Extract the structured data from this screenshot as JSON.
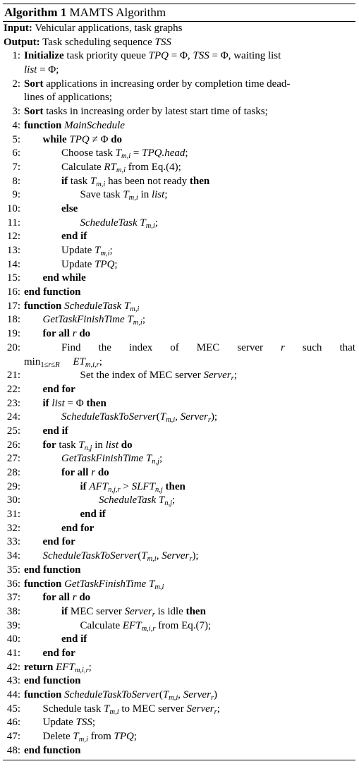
{
  "caption": {
    "prefix": "Algorithm 1",
    "title": "MAMTS Algorithm"
  },
  "input": {
    "label": "Input:",
    "text": "Vehicular applications, task graphs"
  },
  "output": {
    "label": "Output:",
    "text": "Task scheduling sequence ",
    "var": "TSS"
  },
  "lines": [
    {
      "n": "1:",
      "i": 0,
      "html": "<span class='kw'>Initialize</span> task priority queue <span class='it'>TPQ</span> = Φ, <span class='it'>TSS</span> = Φ, waiting list"
    },
    {
      "n": "",
      "i": 0,
      "html": "<span class='it'>list</span> = Φ;"
    },
    {
      "n": "2:",
      "i": 0,
      "html": "<span class='kw'>Sort</span> applications in increasing order by completion time dead-"
    },
    {
      "n": "",
      "i": 0,
      "html": "lines of applications;"
    },
    {
      "n": "3:",
      "i": 0,
      "html": "<span class='kw'>Sort</span> tasks in increasing order by latest start time of tasks;"
    },
    {
      "n": "4:",
      "i": 0,
      "html": "<span class='kw'>function</span> <span class='it'>MainSchedule</span>"
    },
    {
      "n": "5:",
      "i": 1,
      "html": "<span class='kw'>while</span> <span class='it'>TPQ</span> ≠ Φ <span class='kw'>do</span>"
    },
    {
      "n": "6:",
      "i": 2,
      "html": "Choose task <span class='it'>T<sub>m,i</sub></span> = <span class='it'>TPQ.head</span>;"
    },
    {
      "n": "7:",
      "i": 2,
      "html": "Calculate <span class='it'>RT<sub>m,i</sub></span> from Eq.(4);"
    },
    {
      "n": "8:",
      "i": 2,
      "html": "<span class='kw'>if</span> task <span class='it'>T<sub>m,i</sub></span> has been not ready <span class='kw'>then</span>"
    },
    {
      "n": "9:",
      "i": 3,
      "html": "Save task <span class='it'>T<sub>m,i</sub></span> in <span class='it'>list</span>;"
    },
    {
      "n": "10:",
      "i": 2,
      "html": "<span class='kw'>else</span>"
    },
    {
      "n": "11:",
      "i": 3,
      "html": "<span class='it'>ScheduleTask T<sub>m,i</sub></span>;"
    },
    {
      "n": "12:",
      "i": 2,
      "html": "<span class='kw'>end if</span>"
    },
    {
      "n": "13:",
      "i": 2,
      "html": "Update <span class='it'>T<sub>m,i</sub></span>;"
    },
    {
      "n": "14:",
      "i": 2,
      "html": "Update <span class='it'>TPQ</span>;"
    },
    {
      "n": "15:",
      "i": 1,
      "html": "<span class='kw'>end while</span>"
    },
    {
      "n": "16:",
      "i": 0,
      "html": "<span class='kw'>end function</span>"
    },
    {
      "n": "17:",
      "i": 0,
      "html": "<span class='kw'>function</span> <span class='it'>ScheduleTask T<sub>m,i</sub></span>"
    },
    {
      "n": "18:",
      "i": 1,
      "html": "<span class='it'>GetTaskFinishTime T<sub>m,i</sub></span>;"
    },
    {
      "n": "19:",
      "i": 1,
      "html": "<span class='kw'>for all</span> <span class='it'>r</span> <span class='kw'>do</span>"
    },
    {
      "n": "20:",
      "i": 2,
      "justify": true,
      "words": [
        "Find",
        "the",
        "index",
        "of",
        "MEC",
        "server",
        "<span class='it'>r</span>",
        "such",
        "that"
      ]
    },
    {
      "n": "",
      "i": 0,
      "html": "min<sub>1≤<span class='it'>r</span>≤<span class='it'>R</span></sub> &nbsp;&nbsp;&nbsp;&nbsp;<span class='it'>ET<sub>m,i,r</sub></span>;"
    },
    {
      "n": "21:",
      "i": 3,
      "html": "Set the index of MEC server <span class='it'>Server<sub>r</sub></span>;"
    },
    {
      "n": "22:",
      "i": 1,
      "html": "<span class='kw'>end for</span>"
    },
    {
      "n": "23:",
      "i": 1,
      "html": "<span class='kw'>if</span> <span class='it'>list</span> = Φ <span class='kw'>then</span>"
    },
    {
      "n": "24:",
      "i": 2,
      "html": "<span class='it'>ScheduleTaskToServer</span>(<span class='it'>T<sub>m,i</sub></span>, <span class='it'>Server<sub>r</sub></span>);"
    },
    {
      "n": "25:",
      "i": 1,
      "html": "<span class='kw'>end if</span>"
    },
    {
      "n": "26:",
      "i": 1,
      "html": "<span class='kw'>for</span> task <span class='it'>T<sub>n,j</sub></span> in <span class='it'>list</span> <span class='kw'>do</span>"
    },
    {
      "n": "27:",
      "i": 2,
      "html": "<span class='it'>GetTaskFinishTime T<sub>n,j</sub></span>;"
    },
    {
      "n": "28:",
      "i": 2,
      "html": "<span class='kw'>for all</span> <span class='it'>r</span> <span class='kw'>do</span>"
    },
    {
      "n": "29:",
      "i": 3,
      "html": "<span class='kw'>if</span> <span class='it'>AFT<sub>n,j,r</sub></span> &gt; <span class='it'>SLFT<sub>n,j</sub></span> <span class='kw'>then</span>"
    },
    {
      "n": "30:",
      "i": 4,
      "html": "<span class='it'>ScheduleTask T<sub>n,j</sub></span>;"
    },
    {
      "n": "31:",
      "i": 3,
      "html": "<span class='kw'>end if</span>"
    },
    {
      "n": "32:",
      "i": 2,
      "html": "<span class='kw'>end for</span>"
    },
    {
      "n": "33:",
      "i": 1,
      "html": "<span class='kw'>end for</span>"
    },
    {
      "n": "34:",
      "i": 1,
      "html": "<span class='it'>ScheduleTaskToServer</span>(<span class='it'>T<sub>m,i</sub></span>, <span class='it'>Server<sub>r</sub></span>);"
    },
    {
      "n": "35:",
      "i": 0,
      "html": "<span class='kw'>end function</span>"
    },
    {
      "n": "36:",
      "i": 0,
      "html": "<span class='kw'>function</span> <span class='it'>GetTaskFinishTime T<sub>m,i</sub></span>"
    },
    {
      "n": "37:",
      "i": 1,
      "html": "<span class='kw'>for all</span> <span class='it'>r</span> <span class='kw'>do</span>"
    },
    {
      "n": "38:",
      "i": 2,
      "html": "<span class='kw'>if</span> MEC server <span class='it'>Server<sub>r</sub></span> is idle <span class='kw'>then</span>"
    },
    {
      "n": "39:",
      "i": 3,
      "html": "Calculate <span class='it'>EFT<sub>m,i,r</sub></span> from Eq.(7);"
    },
    {
      "n": "40:",
      "i": 2,
      "html": "<span class='kw'>end if</span>"
    },
    {
      "n": "41:",
      "i": 1,
      "html": "<span class='kw'>end for</span>"
    },
    {
      "n": "42:",
      "i": 0,
      "html": "<span class='kw'>return</span> <span class='it'>EFT<sub>m,i,r</sub></span>;"
    },
    {
      "n": "43:",
      "i": 0,
      "html": "<span class='kw'>end function</span>"
    },
    {
      "n": "44:",
      "i": 0,
      "html": "<span class='kw'>function</span> <span class='it'>ScheduleTaskToServer</span>(<span class='it'>T<sub>m,i</sub></span>, <span class='it'>Server<sub>r</sub></span>)"
    },
    {
      "n": "45:",
      "i": 1,
      "html": "Schedule task <span class='it'>T<sub>m,i</sub></span> to MEC server <span class='it'>Server<sub>r</sub></span>;"
    },
    {
      "n": "46:",
      "i": 1,
      "html": "Update <span class='it'>TSS</span>;"
    },
    {
      "n": "47:",
      "i": 1,
      "html": "Delete <span class='it'>T<sub>m,i</sub></span> from <span class='it'>TPQ</span>;"
    },
    {
      "n": "48:",
      "i": 0,
      "html": "<span class='kw'>end function</span>"
    }
  ]
}
